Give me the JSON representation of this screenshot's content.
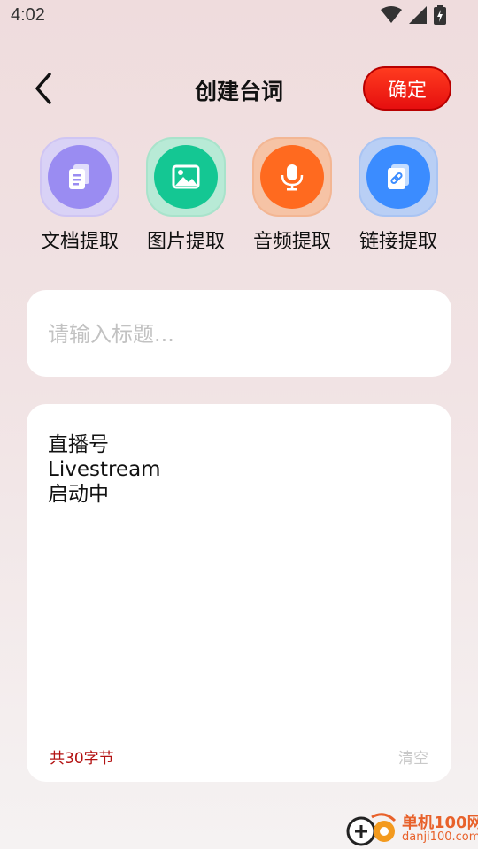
{
  "status_bar": {
    "time": "4:02"
  },
  "header": {
    "title": "创建台词",
    "confirm_label": "确定"
  },
  "tools": [
    {
      "label": "文档提取",
      "icon": "document-icon",
      "color": "#9a8cf2"
    },
    {
      "label": "图片提取",
      "icon": "image-icon",
      "color": "#14c793"
    },
    {
      "label": "音频提取",
      "icon": "microphone-icon",
      "color": "#ff6a1f"
    },
    {
      "label": "链接提取",
      "icon": "link-icon",
      "color": "#3b8cff"
    }
  ],
  "title_input": {
    "placeholder": "请输入标题...",
    "value": ""
  },
  "content": {
    "lines": [
      "直播号",
      "Livestream",
      "启动中"
    ],
    "count_label": "共30字节",
    "clear_label": "清空"
  },
  "watermark": {
    "name": "单机100网",
    "url": "danji100.com"
  }
}
